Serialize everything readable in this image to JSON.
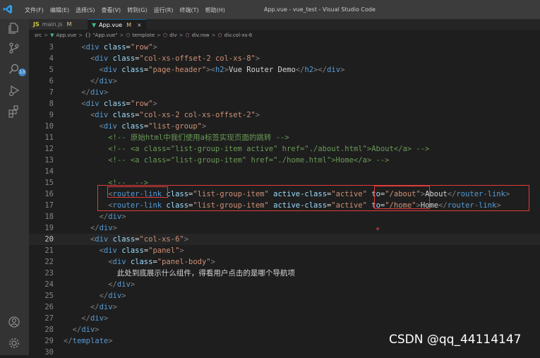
{
  "title_bar": {
    "menu": [
      "文件(F)",
      "编辑(E)",
      "选择(S)",
      "查看(V)",
      "转到(G)",
      "运行(R)",
      "终端(T)",
      "帮助(H)"
    ],
    "window_title": "App.vue - vue_test - Visual Studio Code"
  },
  "activity_bar": {
    "icons": [
      "explorer-icon",
      "source-control-icon",
      "search-icon",
      "run-debug-icon",
      "extensions-icon",
      "account-icon",
      "settings-gear-icon"
    ],
    "scm_badge": "13"
  },
  "tabs": [
    {
      "label": "main.js",
      "status": "M"
    },
    {
      "label": "App.vue",
      "status": "M",
      "close": "×"
    }
  ],
  "breadcrumb": {
    "items": [
      "src",
      "App.vue",
      "{} \"App.vue\"",
      "template",
      "div",
      "div.row",
      "div.col-xs-6"
    ],
    "sep": ">"
  },
  "editor": {
    "current_line": 20,
    "lines": [
      {
        "n": 3,
        "indent": "    ",
        "tokens": [
          [
            "br",
            "<"
          ],
          [
            "tag",
            "div"
          ],
          [
            "txt",
            " "
          ],
          [
            "attr",
            "class"
          ],
          [
            "pun",
            "="
          ],
          [
            "str",
            "\"row\""
          ],
          [
            "br",
            ">"
          ]
        ]
      },
      {
        "n": 4,
        "indent": "      ",
        "tokens": [
          [
            "br",
            "<"
          ],
          [
            "tag",
            "div"
          ],
          [
            "txt",
            " "
          ],
          [
            "attr",
            "class"
          ],
          [
            "pun",
            "="
          ],
          [
            "str",
            "\"col-xs-offset-2 col-xs-8\""
          ],
          [
            "br",
            ">"
          ]
        ]
      },
      {
        "n": 5,
        "indent": "        ",
        "tokens": [
          [
            "br",
            "<"
          ],
          [
            "tag",
            "div"
          ],
          [
            "txt",
            " "
          ],
          [
            "attr",
            "class"
          ],
          [
            "pun",
            "="
          ],
          [
            "str",
            "\"page-header\""
          ],
          [
            "br",
            ">"
          ],
          [
            "br",
            "<"
          ],
          [
            "tag",
            "h2"
          ],
          [
            "br",
            ">"
          ],
          [
            "txt",
            "Vue Router Demo"
          ],
          [
            "br",
            "</"
          ],
          [
            "tag",
            "h2"
          ],
          [
            "br",
            ">"
          ],
          [
            "br",
            "</"
          ],
          [
            "tag",
            "div"
          ],
          [
            "br",
            ">"
          ]
        ]
      },
      {
        "n": 6,
        "indent": "      ",
        "tokens": [
          [
            "br",
            "</"
          ],
          [
            "tag",
            "div"
          ],
          [
            "br",
            ">"
          ]
        ]
      },
      {
        "n": 7,
        "indent": "    ",
        "tokens": [
          [
            "br",
            "</"
          ],
          [
            "tag",
            "div"
          ],
          [
            "br",
            ">"
          ]
        ]
      },
      {
        "n": 8,
        "indent": "    ",
        "tokens": [
          [
            "br",
            "<"
          ],
          [
            "tag",
            "div"
          ],
          [
            "txt",
            " "
          ],
          [
            "attr",
            "class"
          ],
          [
            "pun",
            "="
          ],
          [
            "str",
            "\"row\""
          ],
          [
            "br",
            ">"
          ]
        ]
      },
      {
        "n": 9,
        "indent": "      ",
        "tokens": [
          [
            "br",
            "<"
          ],
          [
            "tag",
            "div"
          ],
          [
            "txt",
            " "
          ],
          [
            "attr",
            "class"
          ],
          [
            "pun",
            "="
          ],
          [
            "str",
            "\"col-xs-2 col-xs-offset-2\""
          ],
          [
            "br",
            ">"
          ]
        ]
      },
      {
        "n": 10,
        "indent": "        ",
        "tokens": [
          [
            "br",
            "<"
          ],
          [
            "tag",
            "div"
          ],
          [
            "txt",
            " "
          ],
          [
            "attr",
            "class"
          ],
          [
            "pun",
            "="
          ],
          [
            "str",
            "\"list-group\""
          ],
          [
            "br",
            ">"
          ]
        ]
      },
      {
        "n": 11,
        "indent": "          ",
        "tokens": [
          [
            "cmt",
            "<!-- 原始html中我们使用a标签实现页面的跳转 -->"
          ]
        ]
      },
      {
        "n": 12,
        "indent": "          ",
        "tokens": [
          [
            "cmt",
            "<!-- <a class=\"list-group-item active\" href=\"./about.html\">About</a> -->"
          ]
        ]
      },
      {
        "n": 13,
        "indent": "          ",
        "tokens": [
          [
            "cmt",
            "<!-- <a class=\"list-group-item\" href=\"./home.html\">Home</a> -->"
          ]
        ]
      },
      {
        "n": 14,
        "indent": "",
        "tokens": []
      },
      {
        "n": 15,
        "indent": "          ",
        "tokens": [
          [
            "cmt",
            "<!--  -->"
          ]
        ]
      },
      {
        "n": 16,
        "indent": "          ",
        "tokens": [
          [
            "br",
            "<"
          ],
          [
            "tag",
            "router-link"
          ],
          [
            "txt",
            " "
          ],
          [
            "attr",
            "class"
          ],
          [
            "pun",
            "="
          ],
          [
            "str",
            "\"list-group-item\""
          ],
          [
            "txt",
            " "
          ],
          [
            "attr",
            "active-class"
          ],
          [
            "pun",
            "="
          ],
          [
            "str",
            "\"active\""
          ],
          [
            "txt",
            " "
          ],
          [
            "attr",
            "to"
          ],
          [
            "pun",
            "="
          ],
          [
            "str",
            "\"/about\""
          ],
          [
            "br",
            ">"
          ],
          [
            "txt",
            "About"
          ],
          [
            "br",
            "</"
          ],
          [
            "tag",
            "router-link"
          ],
          [
            "br",
            ">"
          ]
        ]
      },
      {
        "n": 17,
        "indent": "          ",
        "tokens": [
          [
            "br",
            "<"
          ],
          [
            "tag",
            "router-link"
          ],
          [
            "txt",
            " "
          ],
          [
            "attr",
            "class"
          ],
          [
            "pun",
            "="
          ],
          [
            "str",
            "\"list-group-item\""
          ],
          [
            "txt",
            " "
          ],
          [
            "attr",
            "active-class"
          ],
          [
            "pun",
            "="
          ],
          [
            "str",
            "\"active\""
          ],
          [
            "txt",
            " "
          ],
          [
            "attr",
            "to"
          ],
          [
            "pun",
            "="
          ],
          [
            "str",
            "\"/home\""
          ],
          [
            "br",
            ">"
          ],
          [
            "txt",
            "Home"
          ],
          [
            "br",
            "</"
          ],
          [
            "tag",
            "router-link"
          ],
          [
            "br",
            ">"
          ]
        ]
      },
      {
        "n": 18,
        "indent": "        ",
        "tokens": [
          [
            "br",
            "</"
          ],
          [
            "tag",
            "div"
          ],
          [
            "br",
            ">"
          ]
        ]
      },
      {
        "n": 19,
        "indent": "      ",
        "tokens": [
          [
            "br",
            "</"
          ],
          [
            "tag",
            "div"
          ],
          [
            "br",
            ">"
          ]
        ]
      },
      {
        "n": 20,
        "indent": "      ",
        "tokens": [
          [
            "br",
            "<"
          ],
          [
            "tag",
            "div"
          ],
          [
            "txt",
            " "
          ],
          [
            "attr",
            "class"
          ],
          [
            "pun",
            "="
          ],
          [
            "str",
            "\"col-xs-6\""
          ],
          [
            "br",
            ">"
          ]
        ]
      },
      {
        "n": 21,
        "indent": "        ",
        "tokens": [
          [
            "br",
            "<"
          ],
          [
            "tag",
            "div"
          ],
          [
            "txt",
            " "
          ],
          [
            "attr",
            "class"
          ],
          [
            "pun",
            "="
          ],
          [
            "str",
            "\"panel\""
          ],
          [
            "br",
            ">"
          ]
        ]
      },
      {
        "n": 22,
        "indent": "          ",
        "tokens": [
          [
            "br",
            "<"
          ],
          [
            "tag",
            "div"
          ],
          [
            "txt",
            " "
          ],
          [
            "attr",
            "class"
          ],
          [
            "pun",
            "="
          ],
          [
            "str",
            "\"panel-body\""
          ],
          [
            "br",
            ">"
          ]
        ]
      },
      {
        "n": 23,
        "indent": "            ",
        "tokens": [
          [
            "txt",
            "此处到底展示什么组件，得看用户点击的是哪个导航项"
          ]
        ]
      },
      {
        "n": 24,
        "indent": "          ",
        "tokens": [
          [
            "br",
            "</"
          ],
          [
            "tag",
            "div"
          ],
          [
            "br",
            ">"
          ]
        ]
      },
      {
        "n": 25,
        "indent": "        ",
        "tokens": [
          [
            "br",
            "</"
          ],
          [
            "tag",
            "div"
          ],
          [
            "br",
            ">"
          ]
        ]
      },
      {
        "n": 26,
        "indent": "      ",
        "tokens": [
          [
            "br",
            "</"
          ],
          [
            "tag",
            "div"
          ],
          [
            "br",
            ">"
          ]
        ]
      },
      {
        "n": 27,
        "indent": "    ",
        "tokens": [
          [
            "br",
            "</"
          ],
          [
            "tag",
            "div"
          ],
          [
            "br",
            ">"
          ]
        ]
      },
      {
        "n": 28,
        "indent": "  ",
        "tokens": [
          [
            "br",
            "</"
          ],
          [
            "tag",
            "div"
          ],
          [
            "br",
            ">"
          ]
        ]
      },
      {
        "n": 29,
        "indent": "",
        "tokens": [
          [
            "br",
            "</"
          ],
          [
            "tag",
            "template"
          ],
          [
            "br",
            ">"
          ]
        ]
      },
      {
        "n": 30,
        "indent": "",
        "tokens": []
      }
    ]
  },
  "colors": {
    "br": "#808080",
    "tag": "#569cd6",
    "attr": "#9cdcfe",
    "str": "#ce9178",
    "txt": "#d4d4d4",
    "cmt": "#6a9955",
    "pun": "#d4d4d4",
    "highlight_box": "#e03c3c"
  },
  "watermark": "CSDN @qq_44114147"
}
